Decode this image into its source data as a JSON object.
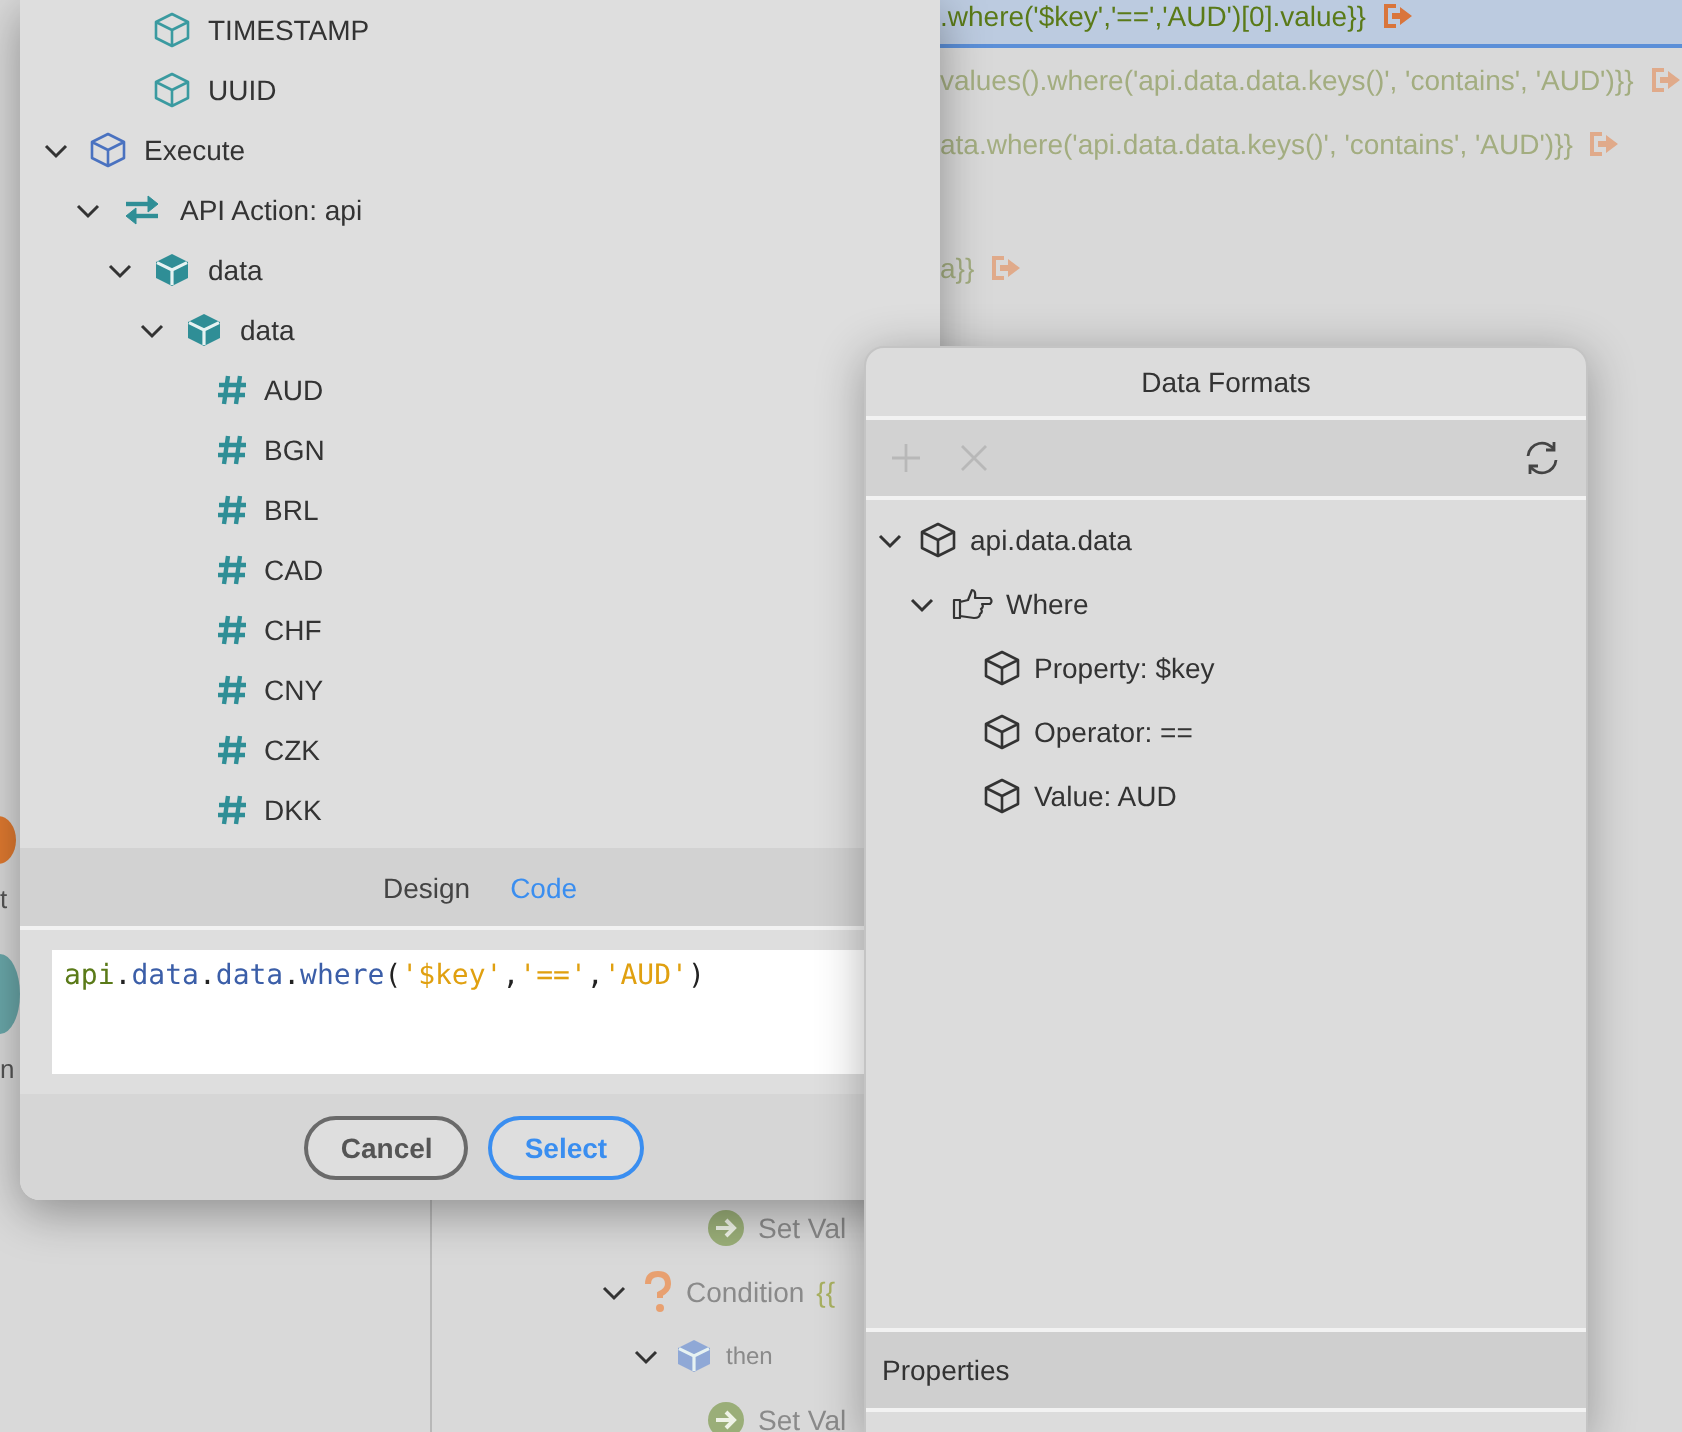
{
  "background": {
    "code_rows": [
      {
        "text": ".where('$key','==','AUD')[0].value}}",
        "selected": true
      },
      {
        "text": "values().where('api.data.data.keys()', 'contains', 'AUD')}}",
        "selected": false
      },
      {
        "text": "ata.where('api.data.data.keys()', 'contains', 'AUD')}}",
        "selected": false
      },
      {
        "text": "a}}",
        "selected": false
      }
    ],
    "side_fragments": [
      {
        "text": "t",
        "kind": "warning"
      },
      {
        "text": "n",
        "kind": "step"
      }
    ],
    "flow": {
      "continued": [
        {
          "kind": "set",
          "label": "Set Val"
        }
      ],
      "items": [
        {
          "kind": "condition",
          "label": "Condition",
          "expression": "{{",
          "expanded": true,
          "children": [
            {
              "kind": "then",
              "label": "then",
              "expanded": true,
              "children": [
                {
                  "kind": "set",
                  "label": "Set Val"
                }
              ]
            }
          ]
        }
      ]
    }
  },
  "dialog": {
    "tree": {
      "continued_children": [
        {
          "label": "TIMESTAMP",
          "kind": "field"
        },
        {
          "label": "UUID",
          "kind": "field"
        }
      ],
      "items": [
        {
          "label": "Execute",
          "kind": "root",
          "expanded": true,
          "children": [
            {
              "label": "API Action: api",
              "kind": "action",
              "expanded": true,
              "children": [
                {
                  "label": "data",
                  "kind": "object",
                  "expanded": true,
                  "children": [
                    {
                      "label": "data",
                      "kind": "object",
                      "expanded": true,
                      "children": [
                        {
                          "label": "AUD",
                          "kind": "number"
                        },
                        {
                          "label": "BGN",
                          "kind": "number"
                        },
                        {
                          "label": "BRL",
                          "kind": "number"
                        },
                        {
                          "label": "CAD",
                          "kind": "number"
                        },
                        {
                          "label": "CHF",
                          "kind": "number"
                        },
                        {
                          "label": "CNY",
                          "kind": "number"
                        },
                        {
                          "label": "CZK",
                          "kind": "number"
                        },
                        {
                          "label": "DKK",
                          "kind": "number"
                        }
                      ]
                    }
                  ]
                }
              ]
            }
          ]
        }
      ]
    },
    "tabs": [
      {
        "label": "Design",
        "selected": false
      },
      {
        "label": "Code",
        "selected": true
      }
    ],
    "code": [
      {
        "text": "api",
        "kind": "variable"
      },
      {
        "text": ".",
        "kind": "punct"
      },
      {
        "text": "data",
        "kind": "member"
      },
      {
        "text": ".",
        "kind": "punct"
      },
      {
        "text": "data",
        "kind": "member"
      },
      {
        "text": ".",
        "kind": "punct"
      },
      {
        "text": "where",
        "kind": "member"
      },
      {
        "text": "(",
        "kind": "punct"
      },
      {
        "text": "'$key'",
        "kind": "string"
      },
      {
        "text": ",",
        "kind": "punct"
      },
      {
        "text": "'=='",
        "kind": "string"
      },
      {
        "text": ",",
        "kind": "punct"
      },
      {
        "text": "'AUD'",
        "kind": "string"
      },
      {
        "text": ")",
        "kind": "punct"
      }
    ],
    "buttons": [
      {
        "label": "Cancel",
        "default": false
      },
      {
        "label": "Select",
        "default": true
      }
    ]
  },
  "data_formats": {
    "title": "Data Formats",
    "toolbar": [
      {
        "kind": "add",
        "disabled": true
      },
      {
        "kind": "remove",
        "disabled": true
      },
      {
        "kind": "refresh",
        "disabled": false
      }
    ],
    "tree": [
      {
        "label": "api.data.data",
        "kind": "object",
        "expanded": true,
        "children": [
          {
            "label": "Where",
            "kind": "filter",
            "expanded": true,
            "children": [
              {
                "label": "Property: $key",
                "kind": "object"
              },
              {
                "label": "Operator: ==",
                "kind": "object"
              },
              {
                "label": "Value: AUD",
                "kind": "object"
              }
            ]
          }
        ]
      }
    ],
    "properties_header": "Properties"
  }
}
